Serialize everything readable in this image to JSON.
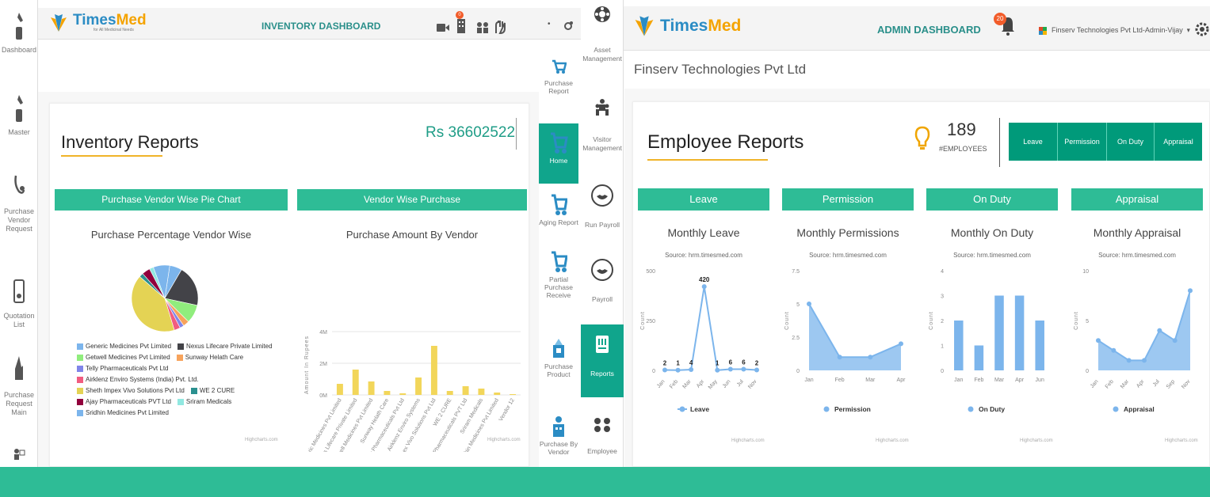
{
  "left_app": {
    "logo": {
      "main": "Times",
      "accent": "Med",
      "tagline": "for All Medicinal Needs"
    },
    "header_title": "INVENTORY DASHBOARD",
    "notification_count": "0",
    "sidebar": [
      {
        "label": "Dashboard",
        "icon": "dashboard-icon"
      },
      {
        "label": "Master",
        "icon": "master-icon"
      },
      {
        "label": "Purchase Vendor Request",
        "icon": "vendor-request-icon"
      },
      {
        "label": "Quotation List",
        "icon": "quotation-icon"
      },
      {
        "label": "Purchase Request Main",
        "icon": "request-main-icon"
      },
      {
        "label": "",
        "icon": "more-icon"
      }
    ],
    "report": {
      "title": "Inventory Reports",
      "total": "Rs 36602522",
      "pie_header": "Purchase Vendor Wise Pie Chart",
      "bar_header": "Vendor Wise Purchase",
      "credit": "Highcharts.com"
    }
  },
  "mid_nav": [
    {
      "label": "Purchase Report",
      "icon": "cart-icon"
    },
    {
      "label": "Home",
      "icon": "home-cart-icon",
      "active": true
    },
    {
      "label": "Aging Report",
      "icon": "cart-icon"
    },
    {
      "label": "Partial Purchase Receive",
      "icon": "cart-icon"
    },
    {
      "label": "Purchase Product",
      "icon": "product-icon"
    },
    {
      "label": "Purchase By Vendor",
      "icon": "vendor-icon"
    }
  ],
  "admin_app": {
    "logo": {
      "main": "Times",
      "accent": "Med"
    },
    "header_title": "ADMIN DASHBOARD",
    "notification_count": "20",
    "user_label": "Finserv Technologies Pvt Ltd-Admin-Vijay",
    "company_name": "Finserv Technologies Pvt Ltd",
    "sidebar": [
      {
        "label": "Asset Management",
        "icon": "asset-icon"
      },
      {
        "label": "Visitor Management",
        "icon": "visitor-icon"
      },
      {
        "label": "Run Payroll",
        "icon": "run-payroll-icon"
      },
      {
        "label": "Payroll",
        "icon": "payroll-icon"
      },
      {
        "label": "Reports",
        "icon": "reports-icon",
        "active": true
      },
      {
        "label": "Employee",
        "icon": "employee-icon"
      }
    ],
    "report": {
      "title": "Employee Reports",
      "employee_count": "189",
      "employee_label": "#EMPLOYEES",
      "buttons": [
        "Leave",
        "Permission",
        "On Duty",
        "Appraisal"
      ],
      "panels": [
        {
          "header": "Leave",
          "title": "Monthly Leave",
          "source": "Source: hrm.timesmed.com",
          "legend": "Leave"
        },
        {
          "header": "Permission",
          "title": "Monthly Permissions",
          "source": "Source: hrm.timesmed.com",
          "legend": "Permission"
        },
        {
          "header": "On Duty",
          "title": "Monthly On Duty",
          "source": "Source: hrm.timesmed.com",
          "legend": "On Duty"
        },
        {
          "header": "Appraisal",
          "title": "Monthly Appraisal",
          "source": "Source: hrm.timesmed.com",
          "legend": "Appraisal"
        }
      ],
      "credit": "Highcharts.com"
    }
  },
  "colors": {
    "accent": "#2ebc96",
    "active_nav": "#10a58c",
    "series_blue": "#7cb5ec",
    "bar_yellow": "#f2d65a"
  },
  "chart_data": [
    {
      "type": "pie",
      "title": "Purchase Percentage Vendor Wise",
      "categories": [
        "Generic Medicines Pvt Limited",
        "Nexus Lifecare Private Limited",
        "Getwell Medicines Pvt Limited",
        "Sunway Helath Care",
        "Telly Pharmaceuticals Pvt Ltd",
        "Airklenz Enviro Systems (India) Pvt. Ltd.",
        "Sheth Impex Vivo Solutions Pvt Ltd",
        "WE 2 CURE",
        "Ajay Pharmaceuticals PVT Ltd",
        "Sriram Medicals",
        "Sridhin Medicines Pvt Limited"
      ],
      "colors": [
        "#7cb5ec",
        "#434348",
        "#90ed7d",
        "#f7a35c",
        "#8085e9",
        "#f15c80",
        "#e4d354",
        "#2b908f",
        "#91003c",
        "#91e8e1",
        "#7cb5ec"
      ],
      "values": [
        6,
        20,
        9,
        3,
        2,
        3,
        41,
        2,
        4,
        2,
        8
      ]
    },
    {
      "type": "bar",
      "title": "Purchase Amount By Vendor",
      "ylabel": "Amount In Rupees",
      "yticks": [
        "0M",
        "2M",
        "4M"
      ],
      "ylim": [
        0,
        4
      ],
      "categories": [
        "Generic Medicines Pvt Limited",
        "Nexus Lifecare Private Limited",
        "Getwell Medicines Pvt Limited",
        "Sunway Helath Care",
        "Telly Pharmaceuticals Pvt Ltd",
        "Airklenz Enviro Systems",
        "Sheth Impex Vivo Solutions Pvt Ltd",
        "WE 2 CURE",
        "Ajay Pharmaceuticals PVT Ltd",
        "Sriram Medicals",
        "Sridhin Medicines Pvt Limited",
        "Vendor 12"
      ],
      "values": [
        0.7,
        1.6,
        0.85,
        0.25,
        0.1,
        1.1,
        3.1,
        0.25,
        0.55,
        0.4,
        0.15,
        0.05
      ],
      "color": "#f2d65a"
    },
    {
      "type": "line",
      "title": "Monthly Leave",
      "ylabel": "Count",
      "yticks": [
        "0",
        "250",
        "500"
      ],
      "ylim": [
        0,
        500
      ],
      "categories": [
        "Jan",
        "Feb",
        "Mar",
        "Apr",
        "May",
        "Jun",
        "Jul",
        "Nov"
      ],
      "series": [
        {
          "name": "Leave",
          "values": [
            2,
            1,
            4,
            420,
            1,
            6,
            6,
            2
          ]
        }
      ]
    },
    {
      "type": "area",
      "title": "Monthly Permissions",
      "ylabel": "Count",
      "yticks": [
        "0",
        "2.5",
        "5",
        "7.5"
      ],
      "ylim": [
        0,
        7.5
      ],
      "categories": [
        "Jan",
        "Feb",
        "Mar",
        "Apr"
      ],
      "series": [
        {
          "name": "Permission",
          "values": [
            5,
            1,
            1,
            2
          ]
        }
      ]
    },
    {
      "type": "bar",
      "title": "Monthly On Duty",
      "ylabel": "Count",
      "yticks": [
        "0",
        "1",
        "2",
        "3",
        "4"
      ],
      "ylim": [
        0,
        4
      ],
      "categories": [
        "Jan",
        "Feb",
        "Mar",
        "Apr",
        "Jun"
      ],
      "series": [
        {
          "name": "On Duty",
          "values": [
            2,
            1,
            3,
            3,
            2
          ]
        }
      ]
    },
    {
      "type": "area",
      "title": "Monthly Appraisal",
      "ylabel": "Count",
      "yticks": [
        "0",
        "5",
        "10"
      ],
      "ylim": [
        0,
        10
      ],
      "categories": [
        "Jan",
        "Feb",
        "Mar",
        "Apr",
        "Jul",
        "Sep",
        "Nov"
      ],
      "series": [
        {
          "name": "Appraisal",
          "values": [
            3,
            2,
            1,
            1,
            4,
            3,
            8
          ]
        }
      ]
    }
  ]
}
